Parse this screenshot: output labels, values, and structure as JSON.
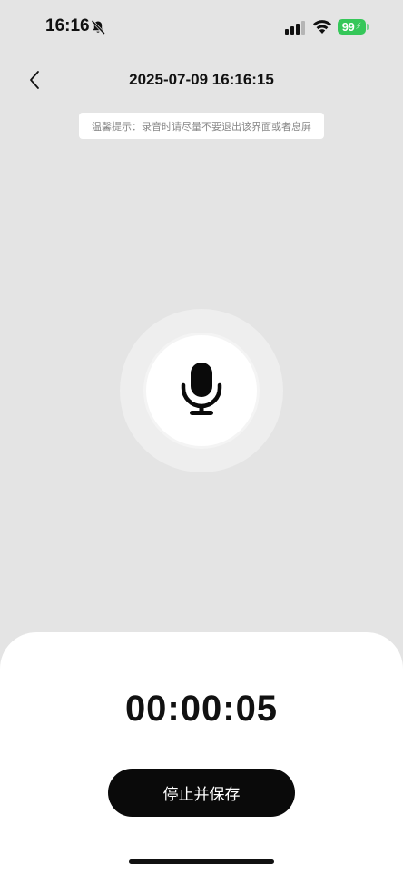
{
  "status_bar": {
    "time": "16:16",
    "battery_level": "99",
    "icons": [
      "bell-slash-icon",
      "cellular-signal-icon",
      "wifi-icon",
      "battery-charging-icon"
    ]
  },
  "header": {
    "back_icon": "chevron-left-icon",
    "title": "2025-07-09 16:16:15"
  },
  "tip": {
    "text": "温馨提示：录音时请尽量不要退出该界面或者息屏"
  },
  "recorder": {
    "icon": "microphone-icon",
    "elapsed": "00:00:05",
    "stop_label": "停止并保存"
  },
  "colors": {
    "background": "#e4e4e4",
    "sheet": "#ffffff",
    "button": "#0a0a0a",
    "battery": "#35c759"
  }
}
